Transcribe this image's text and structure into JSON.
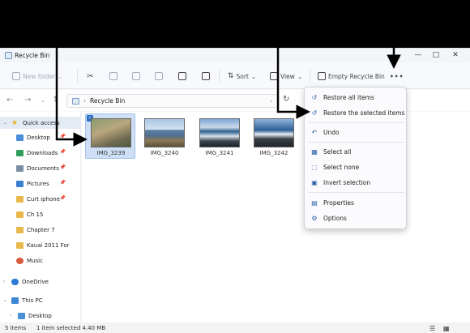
{
  "window": {
    "title": "Recycle Bin"
  },
  "window_controls": {
    "minimize": "—",
    "maximize": "□",
    "close": "✕"
  },
  "toolbar": {
    "new_folder": "New folder",
    "sort": "Sort",
    "view": "View",
    "empty_recycle_bin": "Empty Recycle Bin",
    "more": "•••"
  },
  "address": {
    "path": "Recycle Bin"
  },
  "sidebar": {
    "items": [
      {
        "label": "Quick access",
        "icon": "star-icon"
      },
      {
        "label": "Desktop",
        "icon": "desktop-icon"
      },
      {
        "label": "Downloads",
        "icon": "download-icon"
      },
      {
        "label": "Documents",
        "icon": "document-icon"
      },
      {
        "label": "Pictures",
        "icon": "pictures-icon"
      },
      {
        "label": "Curt iphone",
        "icon": "folder-icon"
      },
      {
        "label": "Ch 15",
        "icon": "folder-icon"
      },
      {
        "label": "Chapter 7",
        "icon": "folder-icon"
      },
      {
        "label": "Kauai 2011 For",
        "icon": "folder-icon"
      },
      {
        "label": "Music",
        "icon": "music-icon"
      },
      {
        "label": "OneDrive",
        "icon": "cloud-icon"
      },
      {
        "label": "This PC",
        "icon": "pc-icon"
      },
      {
        "label": "Desktop",
        "icon": "desktop-icon"
      }
    ]
  },
  "files": [
    {
      "name": "IMG_3239",
      "selected": true
    },
    {
      "name": "IMG_3240",
      "selected": false
    },
    {
      "name": "IMG_3241",
      "selected": false
    },
    {
      "name": "IMG_3242",
      "selected": false
    }
  ],
  "context_menu": {
    "items": [
      {
        "label": "Restore all items",
        "icon": "restore-all-icon"
      },
      {
        "label": "Restore the selected items",
        "icon": "restore-selected-icon"
      },
      {
        "label": "Undo",
        "icon": "undo-icon"
      },
      {
        "label": "Select all",
        "icon": "select-all-icon"
      },
      {
        "label": "Select none",
        "icon": "select-none-icon"
      },
      {
        "label": "Invert selection",
        "icon": "invert-selection-icon"
      },
      {
        "label": "Properties",
        "icon": "properties-icon"
      },
      {
        "label": "Options",
        "icon": "options-icon"
      }
    ]
  },
  "status": {
    "count": "5 items",
    "selection": "1 item selected  4.40 MB"
  },
  "colors": {
    "accent": "#2a6cc3",
    "selection": "#cfe0f6",
    "folder": "#e8b84a"
  }
}
